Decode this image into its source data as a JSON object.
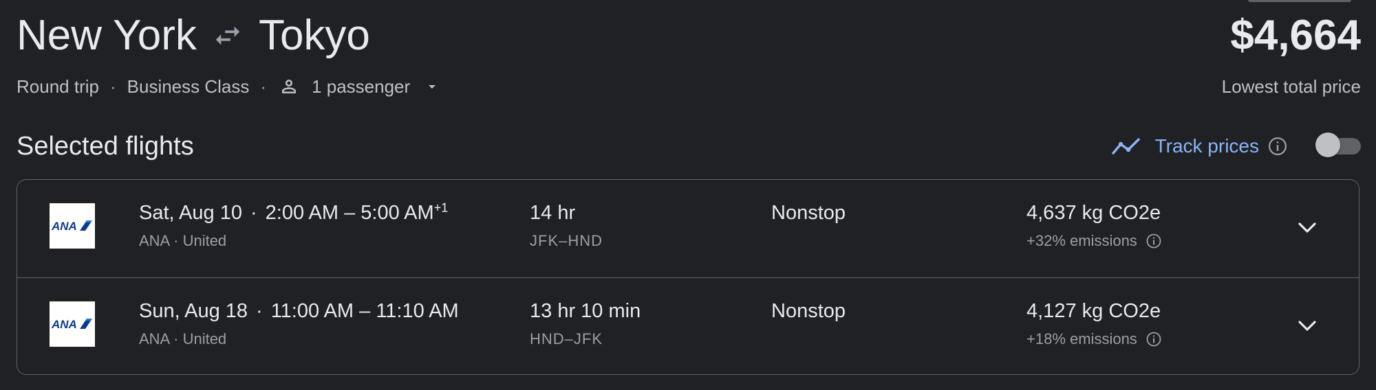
{
  "header": {
    "origin": "New York",
    "destination": "Tokyo",
    "price": "$4,664",
    "price_caption": "Lowest total price",
    "trip_type": "Round trip",
    "cabin": "Business Class",
    "passengers": "1 passenger"
  },
  "section": {
    "title": "Selected flights",
    "track_label": "Track prices",
    "track_enabled": false
  },
  "colors": {
    "background": "#202124",
    "accent": "#8ab4f8",
    "border": "#5f6368"
  },
  "flights": [
    {
      "airline_logo": "ANA",
      "date": "Sat, Aug 10",
      "time_range": "2:00 AM – 5:00 AM",
      "day_offset": "+1",
      "airlines": "ANA · United",
      "duration": "14 hr",
      "airports": "JFK–HND",
      "stops": "Nonstop",
      "emissions": "4,637 kg CO2e",
      "emissions_delta": "+32% emissions"
    },
    {
      "airline_logo": "ANA",
      "date": "Sun, Aug 18",
      "time_range": "11:00 AM – 11:10 AM",
      "day_offset": "",
      "airlines": "ANA · United",
      "duration": "13 hr 10 min",
      "airports": "HND–JFK",
      "stops": "Nonstop",
      "emissions": "4,127 kg CO2e",
      "emissions_delta": "+18% emissions"
    }
  ]
}
